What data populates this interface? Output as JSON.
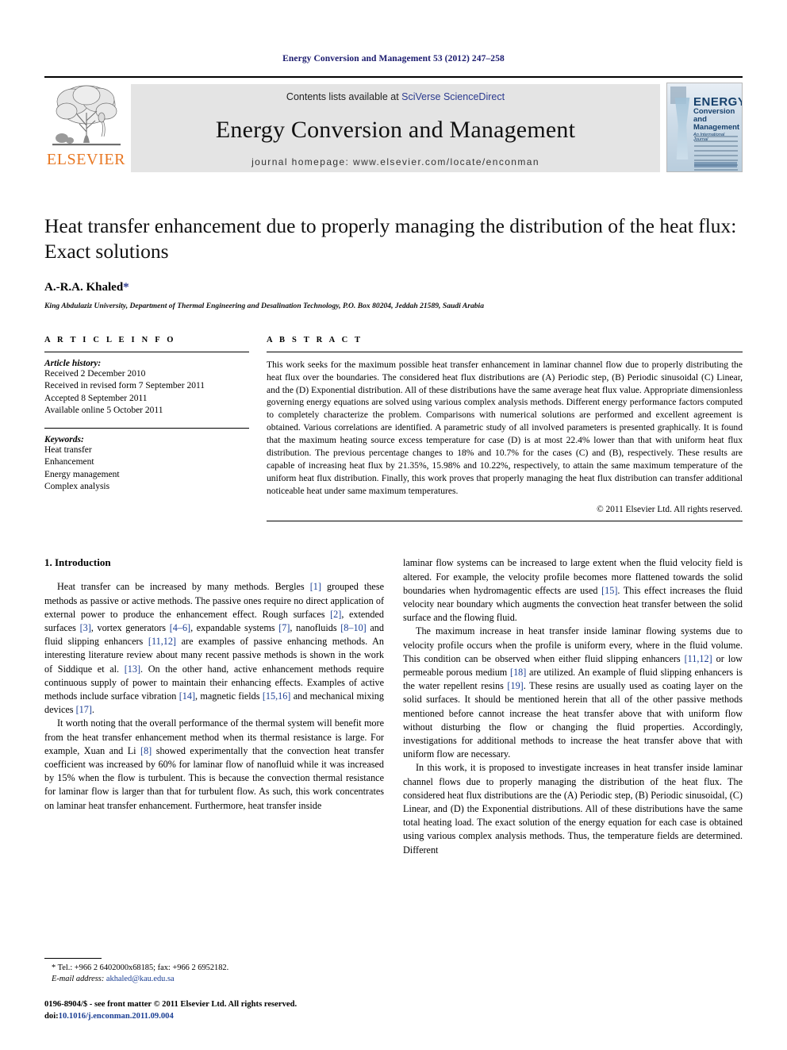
{
  "running_head": "Energy Conversion and Management 53 (2012) 247–258",
  "masthead": {
    "publisher_logo_text": "ELSEVIER",
    "contents_prefix": "Contents lists available at ",
    "contents_link": "SciVerse ScienceDirect",
    "journal_title": "Energy Conversion and Management",
    "homepage_line": "journal homepage: www.elsevier.com/locate/enconman",
    "cover": {
      "line1": "ENERGY",
      "line2": "Conversion and",
      "line3": "Management",
      "line4": "An International Journal"
    }
  },
  "article": {
    "title": "Heat transfer enhancement due to properly managing the distribution of the heat flux: Exact solutions",
    "authors": "A.-R.A. Khaled",
    "author_marker": "*",
    "affiliation": "King Abdulaziz University, Department of Thermal Engineering and Desalination Technology, P.O. Box 80204, Jeddah 21589, Saudi Arabia"
  },
  "article_info": {
    "heading": "A R T I C L E    I N F O",
    "history_label": "Article history:",
    "history": [
      "Received 2 December 2010",
      "Received in revised form 7 September 2011",
      "Accepted 8 September 2011",
      "Available online 5 October 2011"
    ],
    "keywords_label": "Keywords:",
    "keywords": [
      "Heat transfer",
      "Enhancement",
      "Energy management",
      "Complex analysis"
    ]
  },
  "abstract": {
    "heading": "A B S T R A C T",
    "text": "This work seeks for the maximum possible heat transfer enhancement in laminar channel flow due to properly distributing the heat flux over the boundaries. The considered heat flux distributions are (A) Periodic step, (B) Periodic sinusoidal (C) Linear, and the (D) Exponential distribution. All of these distributions have the same average heat flux value. Appropriate dimensionless governing energy equations are solved using various complex analysis methods. Different energy performance factors computed to completely characterize the problem. Comparisons with numerical solutions are performed and excellent agreement is obtained. Various correlations are identified. A parametric study of all involved parameters is presented graphically. It is found that the maximum heating source excess temperature for case (D) is at most 22.4% lower than that with uniform heat flux distribution. The previous percentage changes to 18% and 10.7% for the cases (C) and (B), respectively. These results are capable of increasing heat flux by 21.35%, 15.98% and 10.22%, respectively, to attain the same maximum temperature of the uniform heat flux distribution. Finally, this work proves that properly managing the heat flux distribution can transfer additional noticeable heat under same maximum temperatures.",
    "copyright": "© 2011 Elsevier Ltd. All rights reserved."
  },
  "introduction": {
    "section_title": "1. Introduction",
    "left_paragraphs": [
      "Heat transfer can be increased by many methods. Bergles [1] grouped these methods as passive or active methods. The passive ones require no direct application of external power to produce the enhancement effect. Rough surfaces [2], extended surfaces [3], vortex generators [4–6], expandable systems [7], nanofluids [8–10] and fluid slipping enhancers [11,12] are examples of passive enhancing methods. An interesting literature review about many recent passive methods is shown in the work of Siddique et al. [13]. On the other hand, active enhancement methods require continuous supply of power to maintain their enhancing effects. Examples of active methods include surface vibration [14], magnetic fields [15,16] and mechanical mixing devices [17].",
      "It worth noting that the overall performance of the thermal system will benefit more from the heat transfer enhancement method when its thermal resistance is large. For example, Xuan and Li [8] showed experimentally that the convection heat transfer coefficient was increased by 60% for laminar flow of nanofluid while it was increased by 15% when the flow is turbulent. This is because the convection thermal resistance for laminar flow is larger than that for turbulent flow. As such, this work concentrates on laminar heat transfer enhancement. Furthermore, heat transfer inside"
    ],
    "right_paragraphs": [
      "laminar flow systems can be increased to large extent when the fluid velocity field is altered. For example, the velocity profile becomes more flattened towards the solid boundaries when hydromagentic effects are used [15]. This effect increases the fluid velocity near boundary which augments the convection heat transfer between the solid surface and the flowing fluid.",
      "The maximum increase in heat transfer inside laminar flowing systems due to velocity profile occurs when the profile is uniform every, where in the fluid volume. This condition can be observed when either fluid slipping enhancers [11,12] or low permeable porous medium [18] are utilized. An example of fluid slipping enhancers is the water repellent resins [19]. These resins are usually used as coating layer on the solid surfaces. It should be mentioned herein that all of the other passive methods mentioned before cannot increase the heat transfer above that with uniform flow without disturbing the flow or changing the fluid properties. Accordingly, investigations for additional methods to increase the heat transfer above that with uniform flow are necessary.",
      "In this work, it is proposed to investigate increases in heat transfer inside laminar channel flows due to properly managing the distribution of the heat flux. The considered heat flux distributions are the (A) Periodic step, (B) Periodic sinusoidal, (C) Linear, and (D) the Exponential distributions. All of these distributions have the same total heating load. The exact solution of the energy equation for each case is obtained using various complex analysis methods. Thus, the temperature fields are determined. Different"
    ]
  },
  "footnotes": {
    "corresponding": "* Tel.: +966 2 6402000x68185; fax: +966 2 6952182.",
    "email_label": "E-mail address:",
    "email": "akhaled@kau.edu.sa",
    "issn_line": "0196-8904/$ - see front matter © 2011 Elsevier Ltd. All rights reserved.",
    "doi_label": "doi:",
    "doi": "10.1016/j.enconman.2011.09.004"
  },
  "colors": {
    "link": "#1c3f94",
    "running_head": "#1a1a6e",
    "elsevier_orange": "#E87722",
    "banner_bg": "#e4e4e4"
  }
}
